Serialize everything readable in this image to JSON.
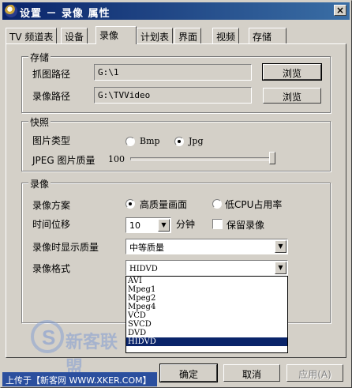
{
  "window": {
    "title": "设置 － 录像 属性",
    "close_glyph": "×"
  },
  "tabs": [
    {
      "label": "TV 频道表"
    },
    {
      "label": "设备"
    },
    {
      "label": "录像",
      "active": true
    },
    {
      "label": "计划表"
    },
    {
      "label": "界面"
    },
    {
      "label": "视频"
    },
    {
      "label": "存储"
    }
  ],
  "storage": {
    "group_label": "存储",
    "capture_label": "抓图路径",
    "capture_path": "G:\\1",
    "record_label": "录像路径",
    "record_path": "G:\\TVVideo",
    "browse_label": "浏览"
  },
  "snapshot": {
    "group_label": "快照",
    "type_label": "图片类型",
    "bmp": "Bmp",
    "jpg": "Jpg",
    "selected_type": "Jpg",
    "quality_label": "JPEG 图片质量",
    "quality_value": "100",
    "quality_fraction": 1.0
  },
  "recording": {
    "group_label": "录像",
    "scheme_label": "录像方案",
    "scheme_high": "高质量画面",
    "scheme_low": "低CPU占用率",
    "selected_scheme": "高质量画面",
    "shift_label": "时间位移",
    "shift_value": "10",
    "shift_unit": "分钟",
    "keep_label": "保留录像",
    "keep_checked": false,
    "display_quality_label": "录像时显示质量",
    "display_quality_value": "中等质量",
    "format_label": "录像格式",
    "format_value": "HIDVD",
    "format_options": [
      "AVI",
      "Mpeg1",
      "Mpeg2",
      "Mpeg4",
      "VCD",
      "SVCD",
      "DVD",
      "HIDVD"
    ],
    "format_selected_index": 7
  },
  "buttons": {
    "ok": "确定",
    "cancel": "取消",
    "apply": "应用(A)"
  },
  "icons": {
    "dropdown": "▼",
    "spinner": "▼"
  },
  "watermark": {
    "letter": "S",
    "text": "新客联盟"
  },
  "footer": {
    "text": "上传于【新客网 WWW.XKER.COM】"
  },
  "colors": {
    "title_bar_start": "#0a246a",
    "title_bar_end": "#3a6ea5",
    "selection": "#0a246a",
    "face": "#d4d0c8"
  }
}
